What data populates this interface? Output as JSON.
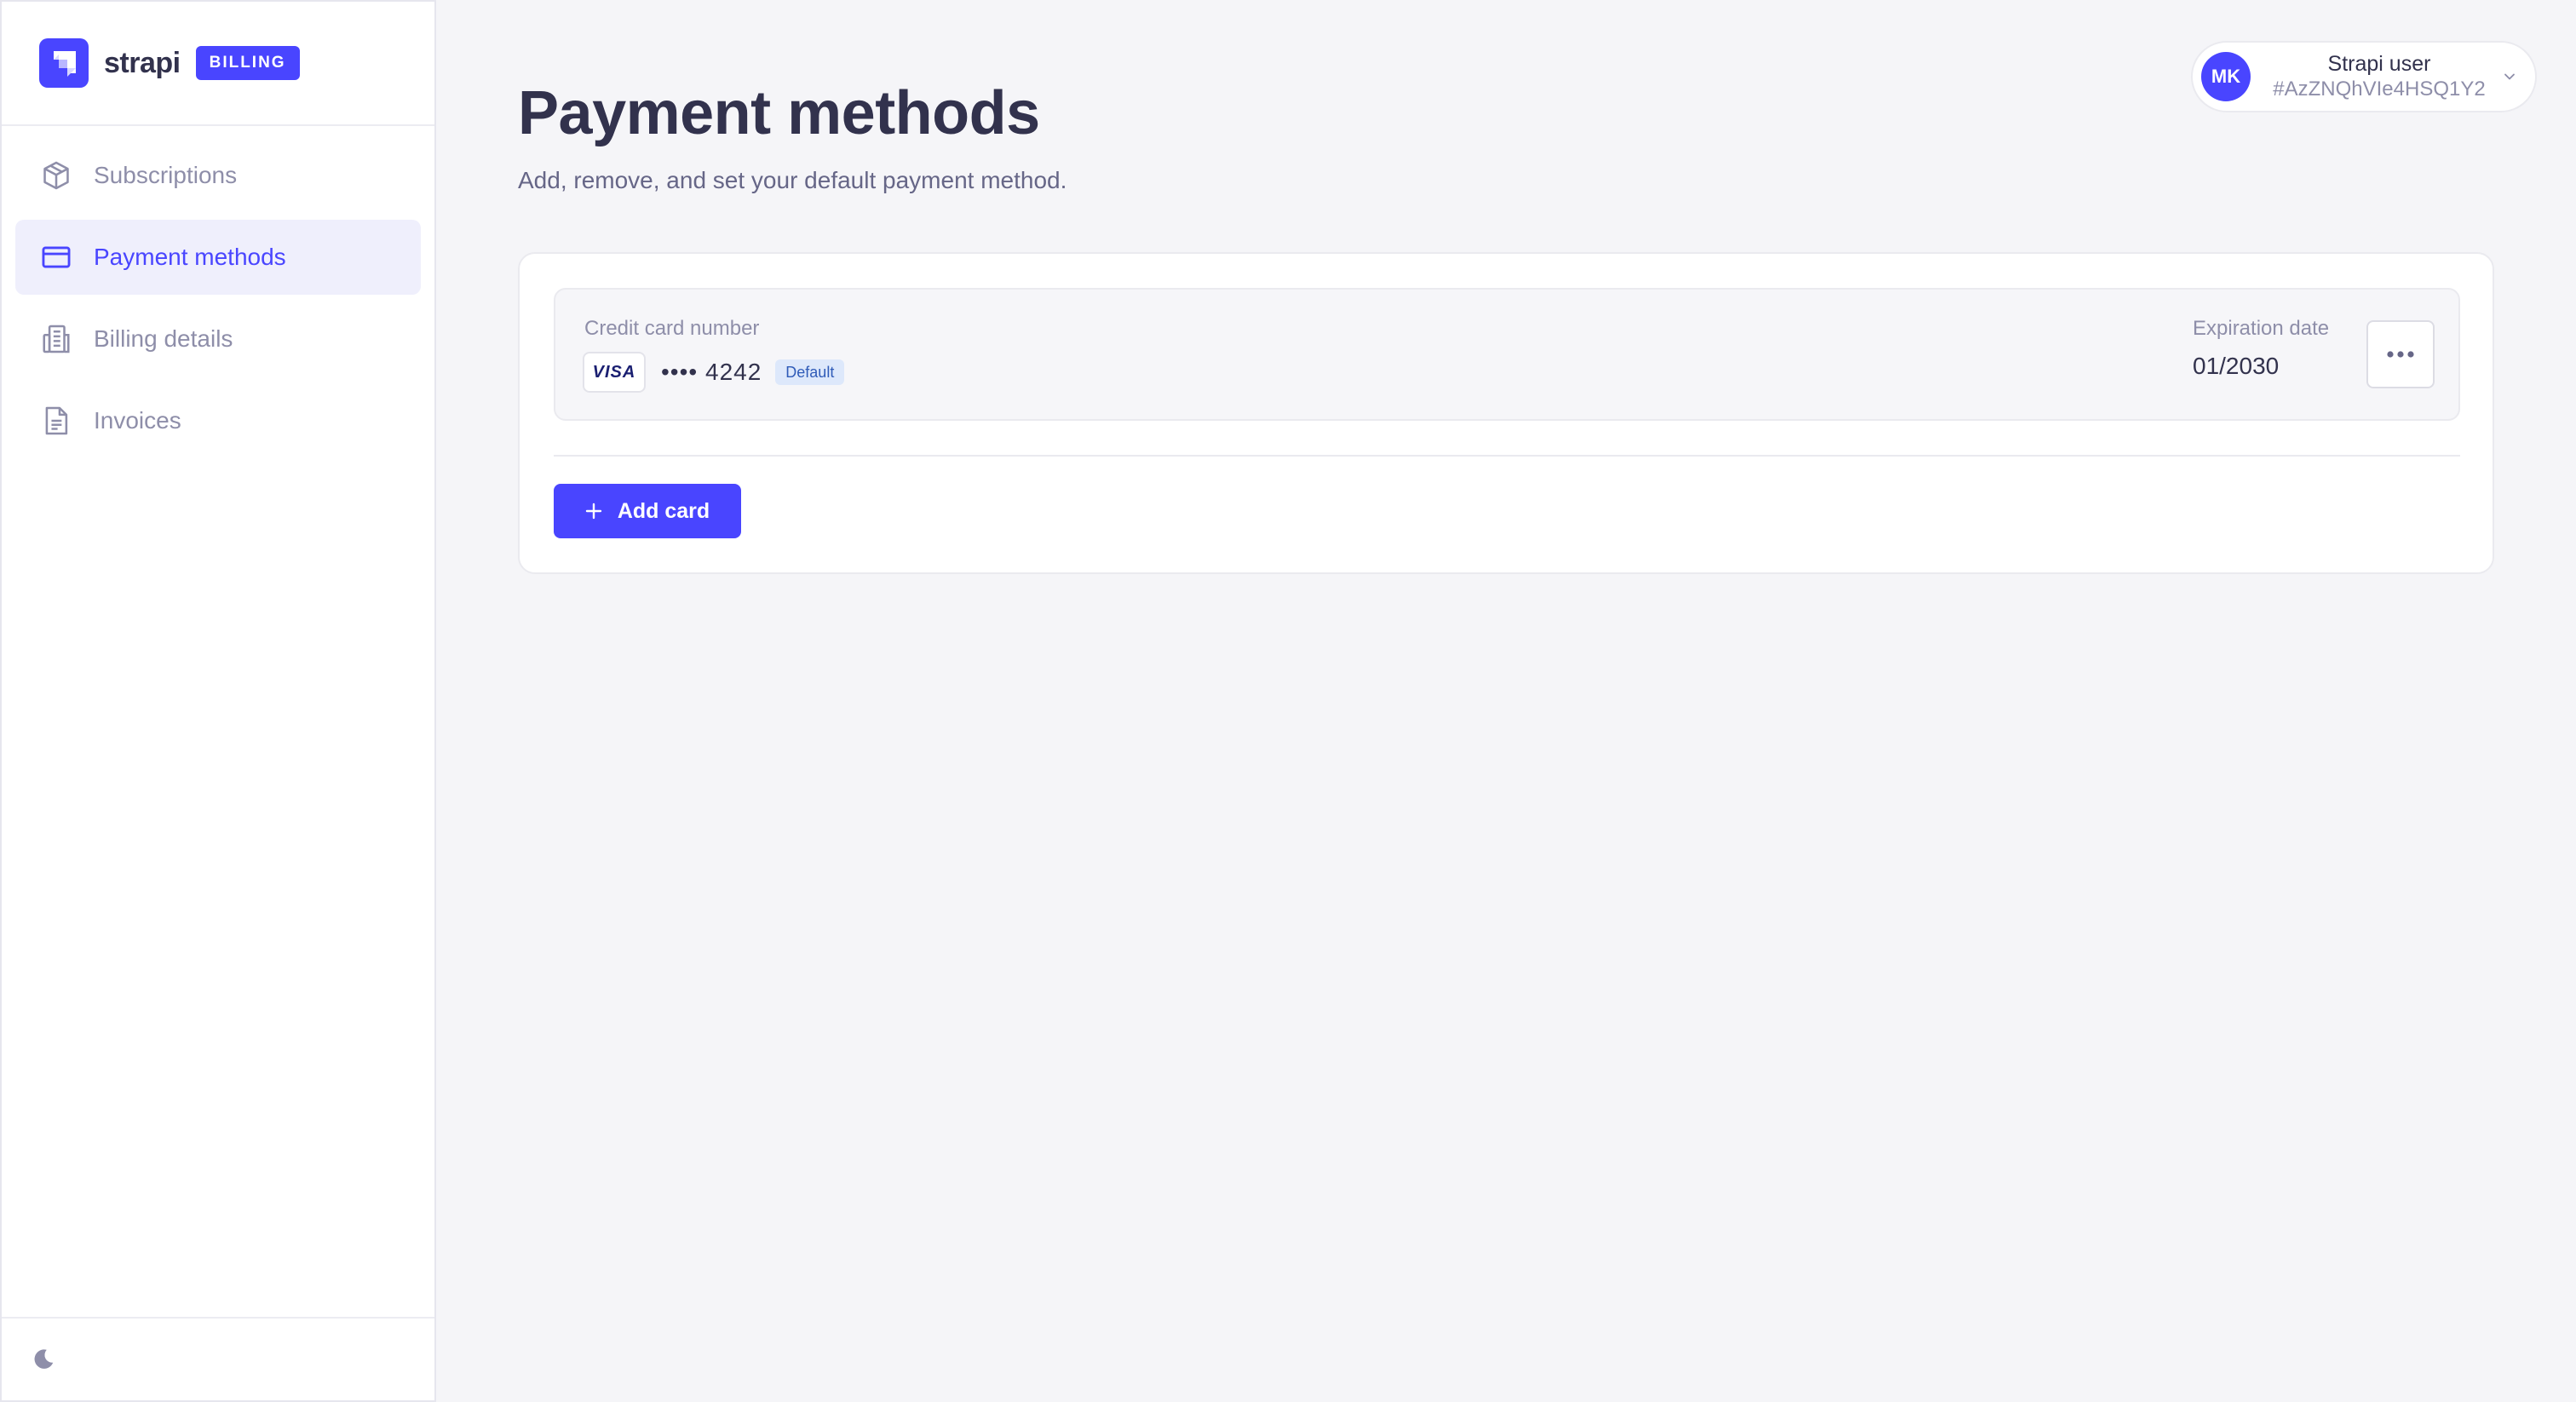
{
  "brand": {
    "name": "strapi",
    "badge": "BILLING"
  },
  "sidebar": {
    "items": [
      {
        "label": "Subscriptions",
        "icon": "package-icon",
        "active": false
      },
      {
        "label": "Payment methods",
        "icon": "credit-card-icon",
        "active": true
      },
      {
        "label": "Billing details",
        "icon": "building-icon",
        "active": false
      },
      {
        "label": "Invoices",
        "icon": "document-icon",
        "active": false
      }
    ],
    "footer_icon": "moon-icon"
  },
  "header": {
    "title": "Payment methods",
    "subtitle": "Add, remove, and set your default payment method."
  },
  "user": {
    "initials": "MK",
    "name": "Strapi user",
    "id": "#AzZNQhVIe4HSQ1Y2"
  },
  "payment_method": {
    "number_label": "Credit card number",
    "brand": "VISA",
    "number": "•••• 4242",
    "default_badge": "Default",
    "expiration_label": "Expiration date",
    "expiration_value": "01/2030"
  },
  "actions": {
    "add_card": "Add card"
  },
  "colors": {
    "accent": "#4945ff",
    "background": "#f5f5f8",
    "text_primary": "#32324d",
    "text_muted": "#8e8ea9",
    "active_nav_bg": "#efeffc",
    "default_badge_bg": "#dde8fb"
  }
}
